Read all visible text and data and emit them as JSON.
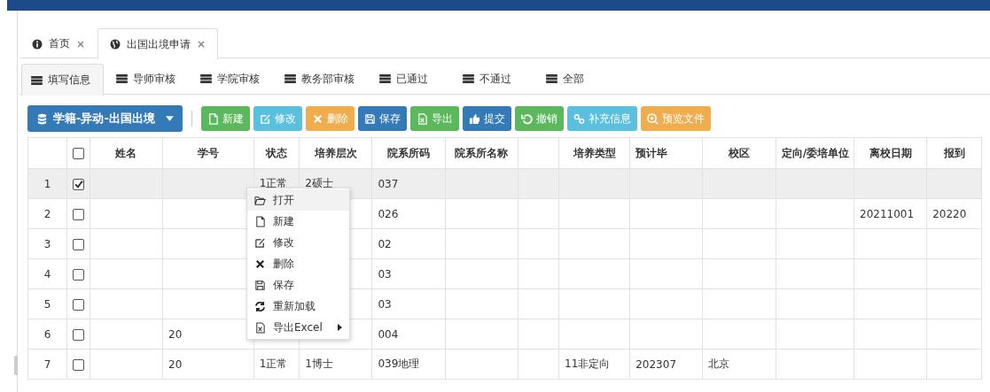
{
  "page_tabs": [
    {
      "label": "首页",
      "selected": false,
      "close": "×"
    },
    {
      "label": "出国出境申请",
      "selected": true,
      "close": "×"
    }
  ],
  "sub_tabs": [
    {
      "label": "填写信息",
      "selected": true
    },
    {
      "label": "导师审核",
      "selected": false
    },
    {
      "label": "学院审核",
      "selected": false
    },
    {
      "label": "教务部审核",
      "selected": false
    },
    {
      "label": "已通过",
      "selected": false
    },
    {
      "label": "不通过",
      "selected": false
    },
    {
      "label": "全部",
      "selected": false
    }
  ],
  "toolbar": {
    "dropdown": "学籍-异动-出国出境",
    "buttons": [
      {
        "label": "新建",
        "kind": "success"
      },
      {
        "label": "修改",
        "kind": "info"
      },
      {
        "label": "删除",
        "kind": "warning"
      },
      {
        "label": "保存",
        "kind": "primary"
      },
      {
        "label": "导出",
        "kind": "success"
      },
      {
        "label": "提交",
        "kind": "primary"
      },
      {
        "label": "撤销",
        "kind": "success"
      },
      {
        "label": "补充信息",
        "kind": "info"
      },
      {
        "label": "预览文件",
        "kind": "warning"
      }
    ]
  },
  "table": {
    "header_checked": false,
    "columns": [
      "姓名",
      "学号",
      "状态",
      "培养层次",
      "院系所码",
      "院系所名称",
      null,
      "培养类型",
      "预计毕",
      "校区",
      "定向/委培单位",
      "离校日期",
      "报到"
    ],
    "rows": [
      {
        "number": "1",
        "checked": true,
        "cells": [
          null,
          null,
          "1正常",
          "2硕士",
          "037"
        ]
      },
      {
        "number": "2",
        "checked": false,
        "cells": [
          null,
          null,
          null,
          null,
          "026",
          null,
          null,
          null,
          null,
          null,
          null,
          "20211001",
          "20220"
        ]
      },
      {
        "number": "3",
        "checked": false,
        "cells": [
          null,
          null,
          null,
          null,
          "02"
        ]
      },
      {
        "number": "4",
        "checked": false,
        "cells": [
          null,
          null,
          null,
          null,
          "03"
        ]
      },
      {
        "number": "5",
        "checked": false,
        "cells": [
          null,
          null,
          null,
          null,
          "03"
        ]
      },
      {
        "number": "6",
        "checked": false,
        "cells": [
          null,
          "20",
          null,
          null,
          "004"
        ]
      },
      {
        "number": "7",
        "checked": false,
        "cells": [
          null,
          "20",
          "1正常",
          "1博士",
          "039地理",
          null,
          null,
          "11非定向",
          "202307",
          "北京"
        ]
      }
    ]
  },
  "context_menu": {
    "items": [
      {
        "label": "打开",
        "selected": true,
        "submenu": false
      },
      {
        "label": "新建",
        "selected": false,
        "submenu": false
      },
      {
        "label": "修改",
        "selected": false,
        "submenu": false
      },
      {
        "label": "删除",
        "selected": false,
        "submenu": false
      },
      {
        "label": "保存",
        "selected": false,
        "submenu": false
      },
      {
        "label": "重新加载",
        "selected": false,
        "submenu": false
      },
      {
        "label": "导出Excel",
        "selected": false,
        "submenu": true
      }
    ]
  }
}
